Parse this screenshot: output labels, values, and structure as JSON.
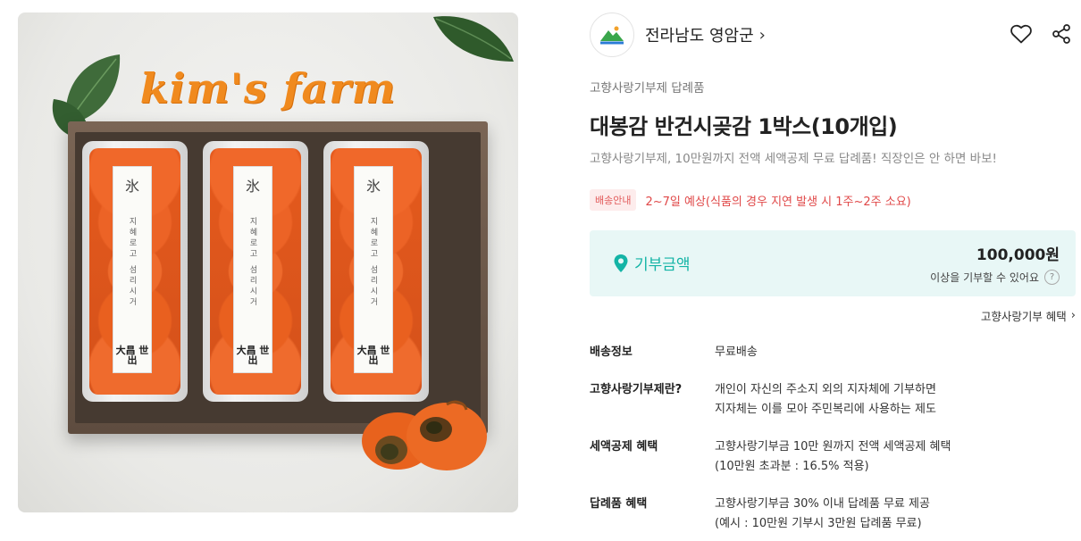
{
  "product_image": {
    "brand": "kim's farm",
    "tray_label_symbol": "氷",
    "tray_label_text": "지혜로고 섬리시거",
    "tray_label_mark": "大昌 世出"
  },
  "seller": {
    "name": "전라남도 영암군",
    "chevron": "›"
  },
  "category": "고향사랑기부제 답례품",
  "title": "대봉감 반건시곶감 1박스(10개입)",
  "subtitle": "고향사랑기부제, 10만원까지 전액 세액공제 무료 답례품! 직장인은 안 하면 바보!",
  "shipping": {
    "badge": "배송안내",
    "text": "2~7일 예상(식품의 경우 지연 발생 시 1주~2주 소요)"
  },
  "donation": {
    "label": "기부금액",
    "amount": "100,000원",
    "note": "이상을 기부할 수 있어요",
    "help": "?"
  },
  "benefit_link": {
    "label": "고향사랑기부 혜택",
    "chevron": "›"
  },
  "info": [
    {
      "key": "배송정보",
      "lines": [
        "무료배송"
      ]
    },
    {
      "key": "고향사랑기부제란?",
      "lines": [
        "개인이 자신의 주소지 외의 지자체에 기부하면",
        "지자체는 이를 모아 주민복리에 사용하는 제도"
      ]
    },
    {
      "key": "세액공제 혜택",
      "lines": [
        "고향사랑기부금 10만 원까지 전액 세액공제 혜택",
        "(10만원 초과분 : 16.5% 적용)"
      ]
    },
    {
      "key": "답례품 혜택",
      "lines": [
        "고향사랑기부금 30% 이내 답례품 무료 제공",
        "(예시 : 10만원 기부시 3만원 답례품 무료)"
      ]
    }
  ],
  "colors": {
    "accent_teal": "#14b4a6",
    "donation_bg": "#e8f7f6",
    "shipping_red": "#e04848",
    "brand_orange": "#f08a1e"
  }
}
